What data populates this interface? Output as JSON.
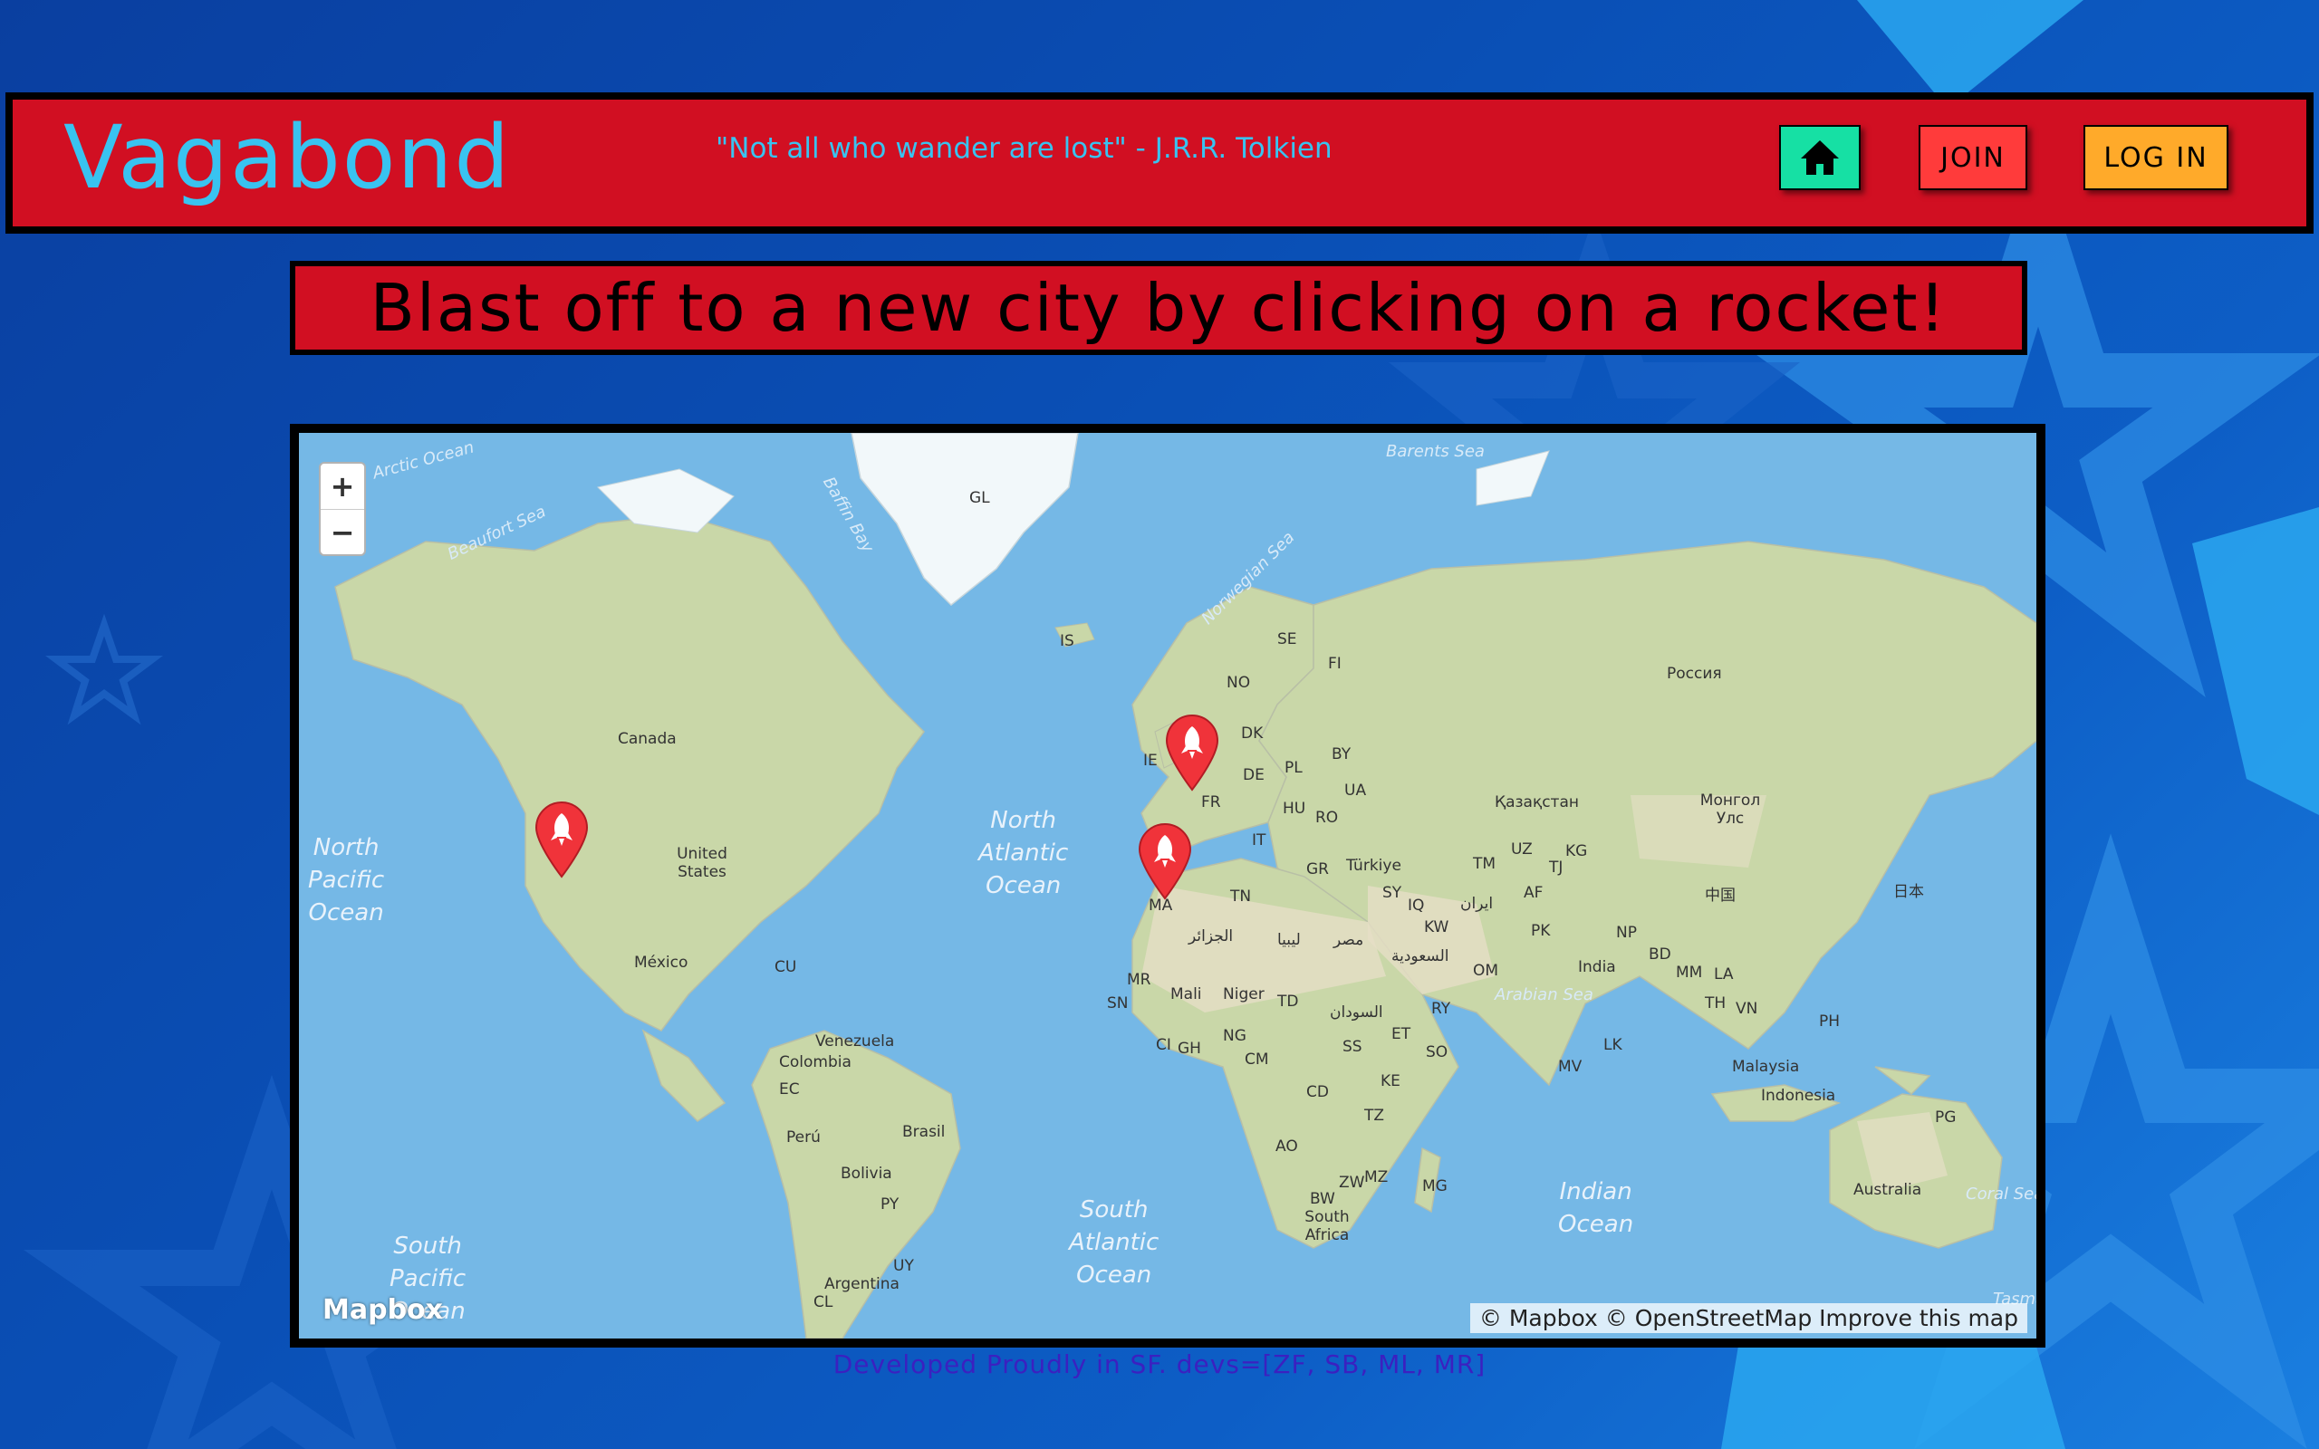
{
  "header": {
    "brand": "Vagabond",
    "quote": "\"Not all who wander are lost\" - J.R.R. Tolkien",
    "home_icon": "home-icon",
    "join_label": "JOIN",
    "login_label": "LOG IN"
  },
  "banner": {
    "text": "Blast off to a new city by clicking on a rocket!"
  },
  "map": {
    "zoom_in": "+",
    "zoom_out": "−",
    "logo": "Mapbox",
    "attribution": "© Mapbox © OpenStreetMap Improve this map",
    "pin_icon": "rocket-pin-icon",
    "oceans": {
      "north_pacific": "North\nPacific\nOcean",
      "north_atlantic": "North\nAtlantic\nOcean",
      "south_atlantic": "South\nAtlantic\nOcean",
      "south_pacific": "South\nPacific\nOcean",
      "indian": "Indian\nOcean"
    },
    "seas": {
      "arctic": "Arctic Ocean",
      "beaufort": "Beaufort Sea",
      "baffin": "Baffin Bay",
      "norwegian": "Norwegian Sea",
      "barents": "Barents Sea",
      "arabian": "Arabian Sea",
      "coral": "Coral Sea",
      "tasman": "Tasma"
    },
    "labels": {
      "gl": "GL",
      "is": "IS",
      "canada": "Canada",
      "us": "United States",
      "mexico": "México",
      "cu": "CU",
      "venezuela": "Venezuela",
      "colombia": "Colombia",
      "ec": "EC",
      "peru": "Perú",
      "brasil": "Brasil",
      "bolivia": "Bolivia",
      "py": "PY",
      "uy": "UY",
      "argentina": "Argentina",
      "cl": "CL",
      "se": "SE",
      "fi": "FI",
      "no": "NO",
      "dk": "DK",
      "ie": "IE",
      "de": "DE",
      "pl": "PL",
      "by": "BY",
      "fr": "FR",
      "hu": "HU",
      "ua": "UA",
      "ro": "RO",
      "it": "IT",
      "gr": "GR",
      "turkiye": "Türkiye",
      "russia": "Россия",
      "kaz": "Қазақстан",
      "mongolia": "Монгол Улс",
      "uz": "UZ",
      "kg": "KG",
      "tm": "TM",
      "tj": "TJ",
      "af": "AF",
      "pk": "PK",
      "iran": "ایران",
      "sy": "SY",
      "iq": "IQ",
      "kw": "KW",
      "saudi": "السعودية",
      "om": "OM",
      "ry": "RY",
      "china": "中国",
      "japan": "日本",
      "np": "NP",
      "india": "India",
      "bd": "BD",
      "mm": "MM",
      "la": "LA",
      "th": "TH",
      "vn": "VN",
      "ph": "PH",
      "lk": "LK",
      "mv": "MV",
      "malaysia": "Malaysia",
      "indonesia": "Indonesia",
      "pg": "PG",
      "australia": "Australia",
      "ma": "MA",
      "tn": "TN",
      "algeria": "الجزائر",
      "libya": "ليبيا",
      "egypt": "مصر",
      "mr": "MR",
      "mali": "Mali",
      "niger": "Niger",
      "td": "TD",
      "sudan": "السودان",
      "sn": "SN",
      "ci": "CI",
      "gh": "GH",
      "ng": "NG",
      "cm": "CM",
      "ss": "SS",
      "et": "ET",
      "so": "SO",
      "ke": "KE",
      "cd": "CD",
      "tz": "TZ",
      "ao": "AO",
      "zw": "ZW",
      "mz": "MZ",
      "mg": "MG",
      "bw": "BW",
      "south_africa": "South Africa"
    }
  },
  "footer": {
    "text": "Developed Proudly in SF. devs=[ZF, SB, ML, MR]"
  }
}
